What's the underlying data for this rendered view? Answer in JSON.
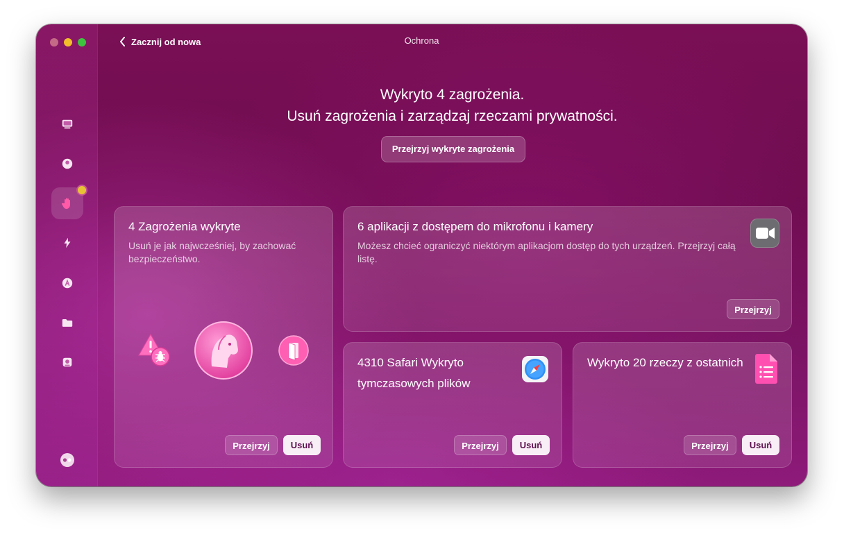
{
  "window": {
    "title": "Ochrona",
    "back_label": "Zacznij od nowa"
  },
  "sidebar": {
    "items": [
      {
        "icon": "monitor-icon"
      },
      {
        "icon": "privacy-ball-icon"
      },
      {
        "icon": "hand-icon",
        "active": true,
        "badge": true
      },
      {
        "icon": "lightning-icon"
      },
      {
        "icon": "app-store-icon"
      },
      {
        "icon": "folder-icon"
      },
      {
        "icon": "disk-icon"
      }
    ],
    "bottom_icon": "assistant-icon"
  },
  "header": {
    "line1": "Wykryto 4 zagrożenia.",
    "line2": "Usuń zagrożenia i zarządzaj rzeczami prywatności.",
    "review_button": "Przejrzyj wykryte zagrożenia"
  },
  "cards": {
    "threats": {
      "title": "4 Zagrożenia wykryte",
      "description": "Usuń je jak najwcześniej, by zachować bezpieczeństwo.",
      "review_label": "Przejrzyj",
      "remove_label": "Usuń"
    },
    "camera": {
      "title": "6 aplikacji z dostępem do mikrofonu i kamery",
      "description": "Możesz chcieć ograniczyć niektórym aplikacjom dostęp do tych urządzeń. Przejrzyj całą listę.",
      "review_label": "Przejrzyj"
    },
    "safari": {
      "title": "4310 Safari Wykryto tymczasowych plików",
      "review_label": "Przejrzyj",
      "remove_label": "Usuń"
    },
    "recent": {
      "title": "Wykryto 20 rzeczy z ostatnich",
      "review_label": "Przejrzyj",
      "remove_label": "Usuń"
    }
  },
  "colors": {
    "accent": "#e8c235",
    "remove_button_bg": "#f8eef6",
    "remove_button_text": "#5e1050"
  }
}
